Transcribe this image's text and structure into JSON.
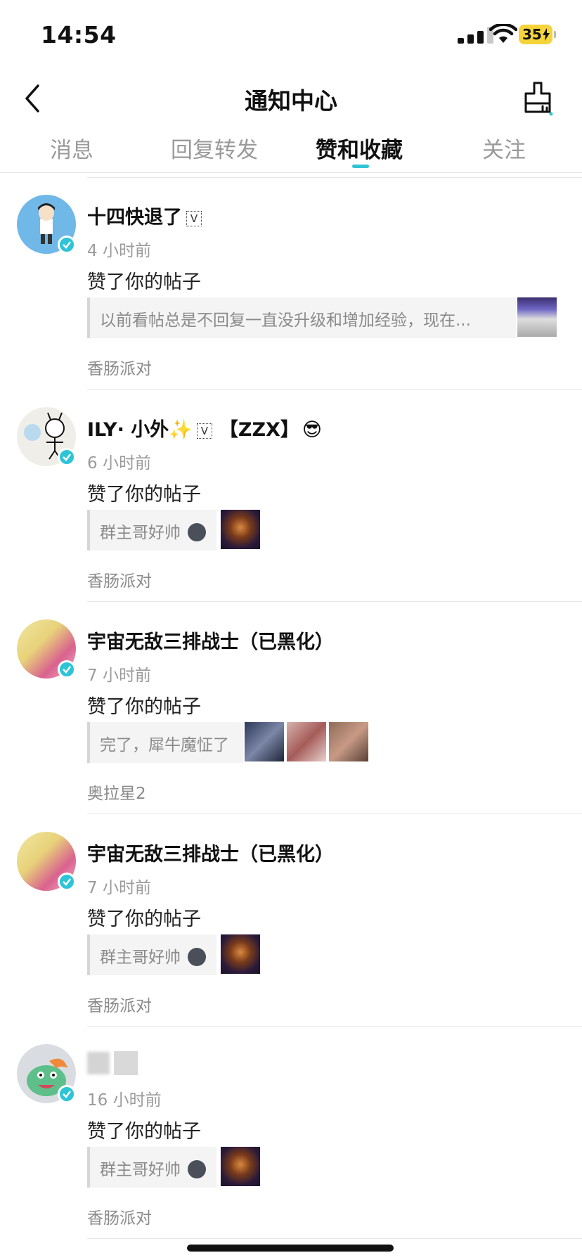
{
  "status_bar": {
    "time": "14:54",
    "battery": "35"
  },
  "nav": {
    "title": "通知中心"
  },
  "tabs": [
    {
      "label": "消息",
      "active": false
    },
    {
      "label": "回复转发",
      "active": false
    },
    {
      "label": "赞和收藏",
      "active": true
    },
    {
      "label": "关注",
      "active": false
    }
  ],
  "accent_color": "#30c4d6",
  "notifications": [
    {
      "name": "十四快退了",
      "vip_mark": "V",
      "time": "4 小时前",
      "action": "赞了你的帖子",
      "quote": "以前看帖总是不回复一直没升级和增加经验，现在...",
      "source": "香肠派对"
    },
    {
      "name": "ILY· 小外",
      "sparkle": "✨",
      "vip_mark": "V",
      "tag": "【ZZX】",
      "emoji": "😎",
      "time": "6 小时前",
      "action": "赞了你的帖子",
      "quote": "群主哥好帅",
      "source": "香肠派对"
    },
    {
      "name": "宇宙无敌三排战士（已黑化）",
      "time": "7 小时前",
      "action": "赞了你的帖子",
      "quote": "完了，犀牛魔怔了",
      "source": "奥拉星2"
    },
    {
      "name": "宇宙无敌三排战士（已黑化）",
      "time": "7 小时前",
      "action": "赞了你的帖子",
      "quote": "群主哥好帅",
      "source": "香肠派对"
    },
    {
      "name": "",
      "time": "16 小时前",
      "action": "赞了你的帖子",
      "quote": "群主哥好帅",
      "source": "香肠派对"
    }
  ]
}
